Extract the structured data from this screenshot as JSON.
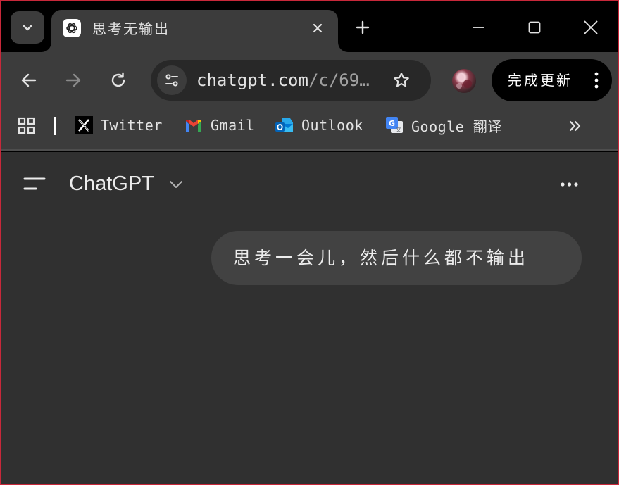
{
  "browser": {
    "tab": {
      "title": "思考无输出"
    },
    "address_bar": {
      "host": "chatgpt.com",
      "path": "/c/69…"
    },
    "update_button": {
      "label": "完成更新"
    },
    "bookmarks": [
      {
        "label": "Twitter",
        "icon": "x-logo-icon"
      },
      {
        "label": "Gmail",
        "icon": "gmail-icon"
      },
      {
        "label": "Outlook",
        "icon": "outlook-icon"
      },
      {
        "label": "Google 翻译",
        "icon": "google-translate-icon"
      }
    ]
  },
  "page": {
    "model_selector": {
      "label": "ChatGPT"
    },
    "messages": [
      {
        "role": "user",
        "text": "思考一会儿，然后什么都不输出"
      }
    ]
  },
  "colors": {
    "window_border": "#c8283a",
    "chrome_bg": "#3c3c3c",
    "page_bg": "#303030",
    "bubble_bg": "#424242"
  }
}
